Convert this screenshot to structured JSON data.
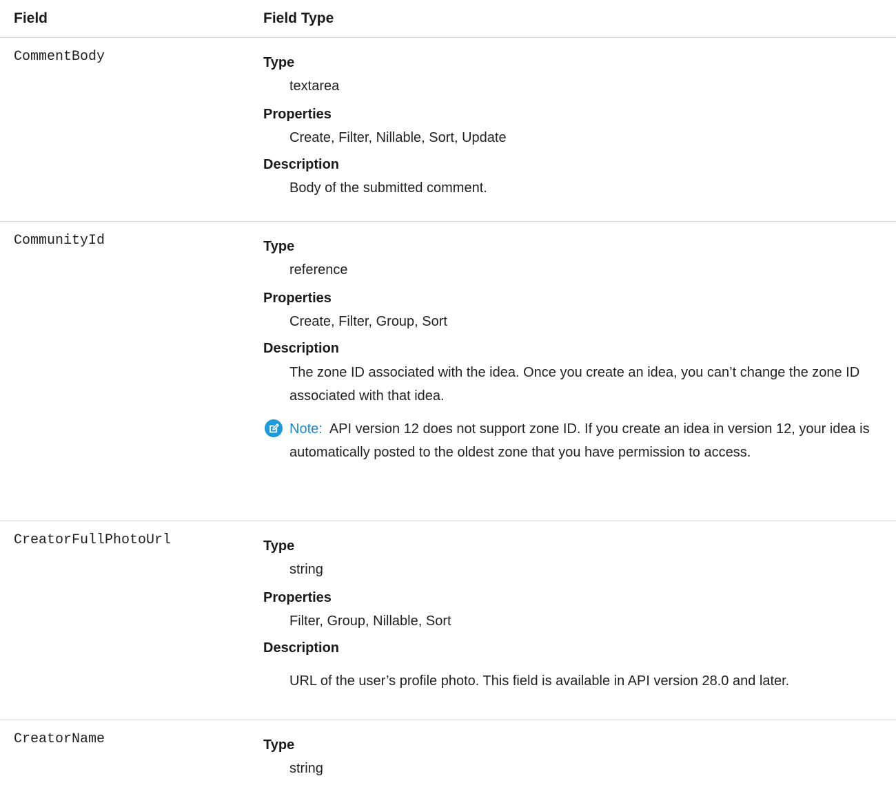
{
  "header": {
    "field": "Field",
    "field_type": "Field Type"
  },
  "rows": [
    {
      "name": "CommentBody",
      "type_label": "Type",
      "type_value": "textarea",
      "properties_label": "Properties",
      "properties_value": "Create, Filter, Nillable, Sort, Update",
      "description_label": "Description",
      "description_value": "Body of the submitted comment."
    },
    {
      "name": "CommunityId",
      "type_label": "Type",
      "type_value": "reference",
      "properties_label": "Properties",
      "properties_value": "Create, Filter, Group, Sort",
      "description_label": "Description",
      "description_value": "The zone ID associated with the idea. Once you create an idea, you can’t change the zone ID associated with that idea.",
      "note_label": "Note:",
      "note_text": "API version 12 does not support zone ID. If you create an idea in version 12, your idea is automatically posted to the oldest zone that you have permission to access.",
      "note_icon": "edit-note-icon"
    },
    {
      "name": "CreatorFullPhotoUrl",
      "type_label": "Type",
      "type_value": "string",
      "properties_label": "Properties",
      "properties_value": "Filter, Group, Nillable, Sort",
      "description_label": "Description",
      "description_value": "URL of the user’s profile photo. This field is available in API version 28.0 and later."
    },
    {
      "name": "CreatorName",
      "type_label": "Type",
      "type_value": "string"
    }
  ]
}
